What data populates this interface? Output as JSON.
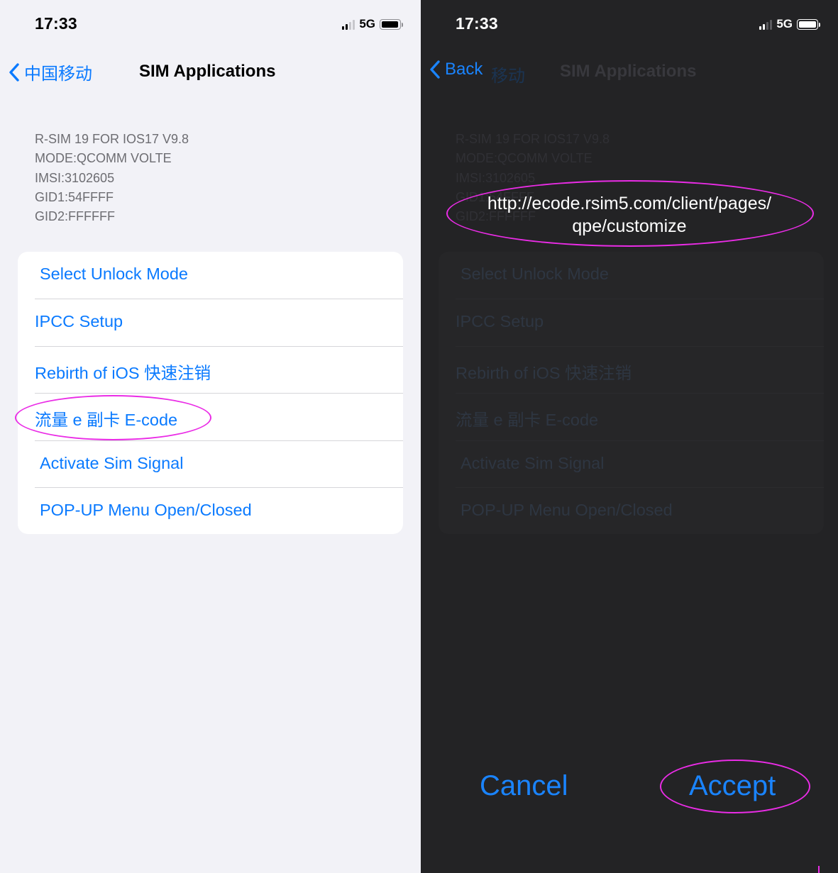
{
  "left": {
    "status_bar": {
      "time": "17:33",
      "network": "5G"
    },
    "nav": {
      "back_label": "中国移动",
      "title": "SIM Applications"
    },
    "info_lines": [
      "R-SIM 19    FOR IOS17 V9.8",
      "MODE:QCOMM VOLTE",
      "IMSI:3102605",
      "GID1:54FFFF",
      "GID2:FFFFFF"
    ],
    "menu_items": [
      {
        "label": "Select Unlock Mode"
      },
      {
        "label": "IPCC Setup"
      },
      {
        "label": "Rebirth of iOS 快速注销"
      },
      {
        "label": "流量 e 副卡 E-code"
      },
      {
        "label": "Activate Sim Signal"
      },
      {
        "label": "POP-UP Menu Open/Closed"
      }
    ]
  },
  "right": {
    "status_bar": {
      "time": "17:33",
      "network": "5G"
    },
    "nav": {
      "back_label": "Back",
      "behind_back_label": "移动",
      "title": "SIM Applications"
    },
    "info_lines": [
      "R-SIM 19    FOR IOS17 V9.8",
      "MODE:QCOMM VOLTE",
      "IMSI:3102605",
      "GID1:54FFFF",
      "GID2:FFFFFF"
    ],
    "menu_items": [
      {
        "label": "Select Unlock Mode"
      },
      {
        "label": "IPCC Setup"
      },
      {
        "label": "Rebirth of iOS 快速注销"
      },
      {
        "label": "流量 e 副卡 E-code"
      },
      {
        "label": "Activate Sim Signal"
      },
      {
        "label": "POP-UP Menu Open/Closed"
      }
    ],
    "alert": {
      "message_line1": "http://ecode.rsim5.com/client/pages/",
      "message_line2": "qpe/customize",
      "cancel_label": "Cancel",
      "accept_label": "Accept"
    }
  },
  "colors": {
    "accent": "#0a7aff",
    "highlight": "#ea2ce6",
    "light_bg": "#f2f2f7",
    "dark_bg": "#232325"
  }
}
